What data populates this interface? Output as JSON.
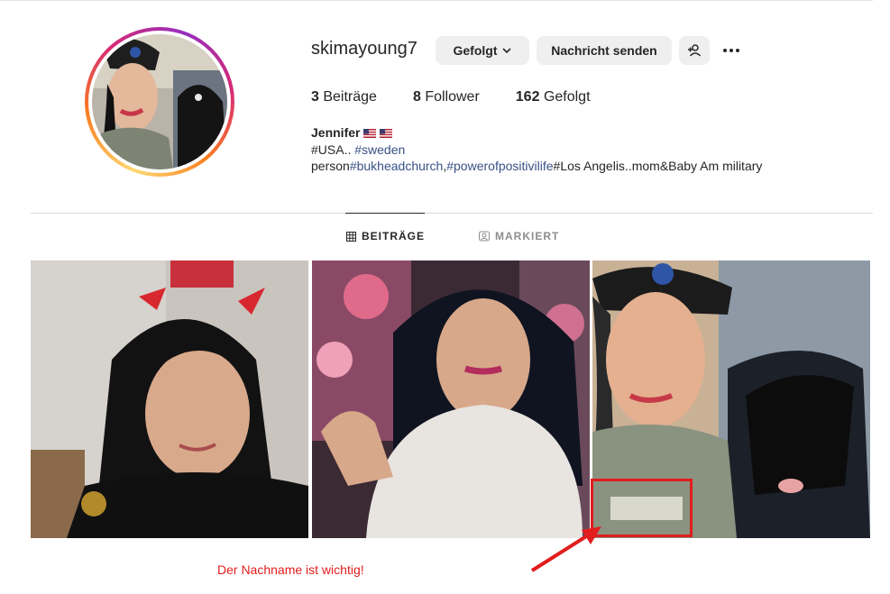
{
  "profile": {
    "username": "skimayoung7",
    "follow_label": "Gefolgt",
    "message_label": "Nachricht senden",
    "stats": {
      "posts_count": "3",
      "posts_label": "Beiträge",
      "followers_count": "8",
      "followers_label": "Follower",
      "following_count": "162",
      "following_label": "Gefolgt"
    },
    "bio": {
      "name": "Jennifer",
      "line1_prefix": "#USA.. ",
      "line1_tag": "#sweden",
      "line2_prefix": "person",
      "line2_tag1": "#bukheadchurch",
      "line2_sep": ",",
      "line2_tag2": "#powerofpositivilife",
      "line2_suffix": "#Los Angelis..mom&Baby Am military"
    }
  },
  "tabs": [
    {
      "label": "BEITRÄGE",
      "icon": "grid-icon",
      "active": true
    },
    {
      "label": "MARKIERT",
      "icon": "tagged-icon",
      "active": false
    }
  ],
  "annotation": {
    "text": "Der Nachname ist wichtig!",
    "color": "#e11d1d"
  },
  "icons": {
    "follow_dropdown": "chevron-down-icon",
    "add_friend": "add-person-icon",
    "more": "more-dots-icon"
  },
  "colors": {
    "button_bg": "#efefef",
    "hashtag": "#385185",
    "annotation": "#e11d1d"
  }
}
